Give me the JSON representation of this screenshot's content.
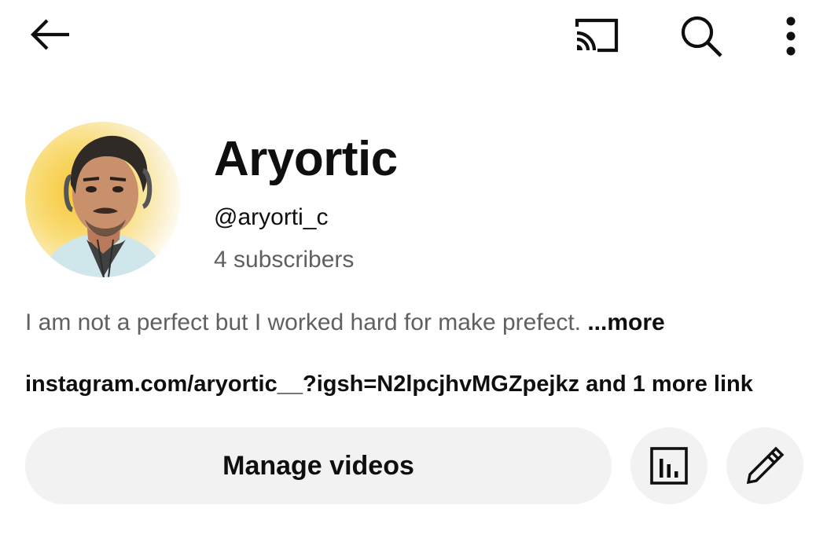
{
  "top_bar": {
    "back_icon": "arrow-left-icon",
    "cast_icon": "cast-icon",
    "search_icon": "search-icon",
    "more_icon": "more-vertical-icon"
  },
  "channel": {
    "name": "Aryortic",
    "handle": "@aryorti_c",
    "subscribers": "4 subscribers",
    "avatar_icon": "avatar-photo"
  },
  "description": {
    "text": "I am not a perfect but I worked hard for make prefect. ",
    "more_label": "...more"
  },
  "links": {
    "text": "instagram.com/aryortic__?igsh=N2lpcjhvMGZpejkz and 1 more link"
  },
  "actions": {
    "manage_label": "Manage videos",
    "analytics_icon": "analytics-icon",
    "edit_icon": "pencil-icon"
  }
}
